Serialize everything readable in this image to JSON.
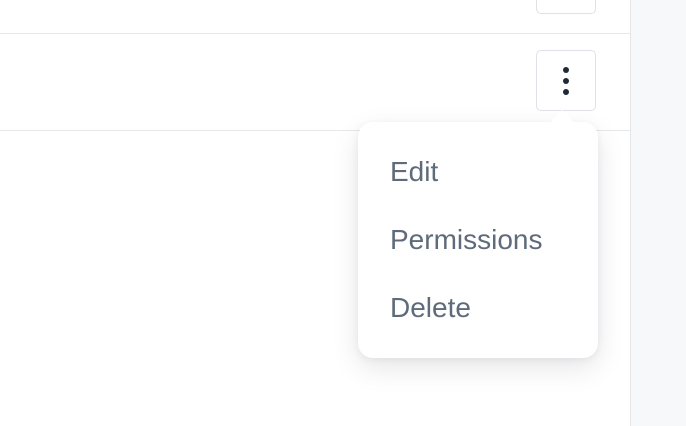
{
  "menu": {
    "items": [
      {
        "label": "Edit"
      },
      {
        "label": "Permissions"
      },
      {
        "label": "Delete"
      }
    ]
  },
  "icons": {
    "row_actions": "more-vertical-icon"
  },
  "colors": {
    "menu_text": "#5f6b7a",
    "icon": "#1f2937",
    "border": "#e5e7eb",
    "gutter": "#f7f8fa"
  }
}
